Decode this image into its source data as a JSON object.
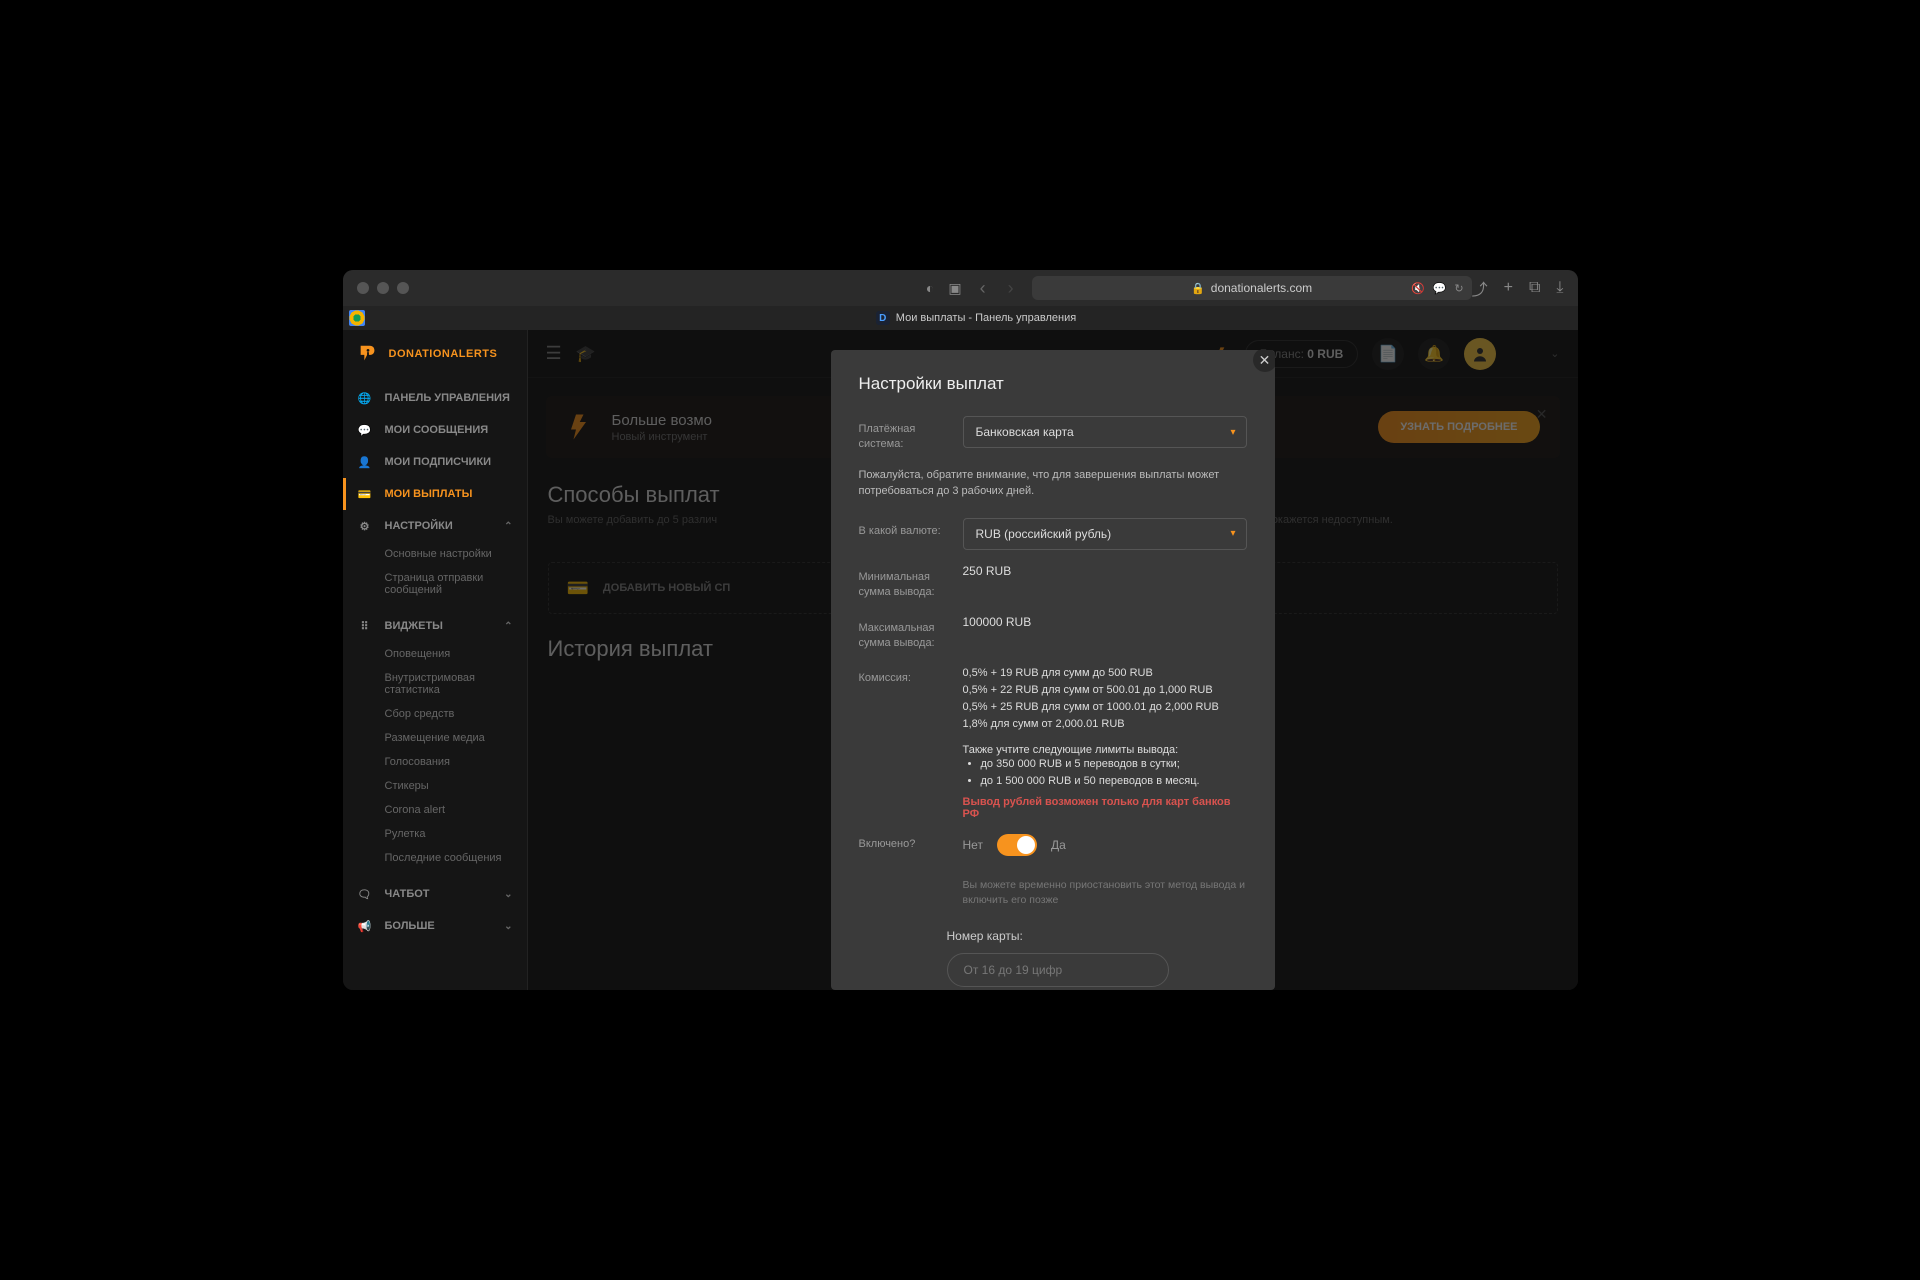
{
  "browser": {
    "url": "donationalerts.com",
    "tab_title": "Мои выплаты - Панель управления"
  },
  "logo_text": "DONATIONALERTS",
  "sidebar": {
    "items": [
      {
        "label": "ПАНЕЛЬ УПРАВЛЕНИЯ"
      },
      {
        "label": "МОИ СООБЩЕНИЯ"
      },
      {
        "label": "МОИ ПОДПИСЧИКИ"
      },
      {
        "label": "МОИ ВЫПЛАТЫ"
      },
      {
        "label": "НАСТРОЙКИ"
      },
      {
        "label": "ВИДЖЕТЫ"
      },
      {
        "label": "ЧАТБОТ"
      },
      {
        "label": "БОЛЬШЕ"
      }
    ],
    "settings_sub": [
      {
        "label": "Основные настройки"
      },
      {
        "label": "Страница отправки сообщений"
      }
    ],
    "widgets_sub": [
      {
        "label": "Оповещения"
      },
      {
        "label": "Внутристримовая статистика"
      },
      {
        "label": "Сбор средств"
      },
      {
        "label": "Размещение медиа"
      },
      {
        "label": "Голосования"
      },
      {
        "label": "Стикеры"
      },
      {
        "label": "Corona alert"
      },
      {
        "label": "Рулетка"
      },
      {
        "label": "Последние сообщения"
      }
    ]
  },
  "topbar": {
    "balance_label": "Баланс:",
    "balance_value": "0 RUB"
  },
  "banner": {
    "title": "Больше возмо",
    "subtitle": "Новый инструмент",
    "button": "УЗНАТЬ ПОДРОБНЕЕ"
  },
  "sections": {
    "methods_title": "Способы выплат",
    "methods_desc_left": "Вы можете добавить до 5 различ",
    "methods_desc_right": "итетный способ вывода окажется недоступным.",
    "add_method": "ДОБАВИТЬ НОВЫЙ СП",
    "history_title": "История выплат"
  },
  "modal": {
    "title": "Настройки выплат",
    "payment_system_label": "Платёжная система:",
    "payment_system_value": "Банковская карта",
    "notice": "Пожалуйста, обратите внимание, что для завершения выплаты может потребоваться до 3 рабочих дней.",
    "currency_label": "В какой валюте:",
    "currency_value": "RUB (российский рубль)",
    "min_label": "Минимальная сумма вывода:",
    "min_value": "250 RUB",
    "max_label": "Максимальная сумма вывода:",
    "max_value": "100000 RUB",
    "fee_label": "Комиссия:",
    "fees": [
      "0,5% + 19 RUB для сумм до 500 RUB",
      "0,5% + 22 RUB для сумм от 500.01 до 1,000 RUB",
      "0,5% + 25 RUB для сумм от 1000.01 до 2,000 RUB",
      "1,8% для сумм от 2,000.01 RUB"
    ],
    "limits_title": "Также учтите следующие лимиты вывода:",
    "limits": [
      "до 350 000 RUB и 5 переводов в сутки;",
      "до 1 500 000 RUB и 50 переводов в месяц."
    ],
    "warning": "Вывод рублей возможен только для карт банков РФ",
    "enabled_label": "Включено?",
    "no": "Нет",
    "yes": "Да",
    "enabled_hint": "Вы можете временно приостановить этот метод вывода и включить его позже",
    "card_label": "Номер карты:",
    "card_placeholder": "От 16 до 19 цифр"
  }
}
